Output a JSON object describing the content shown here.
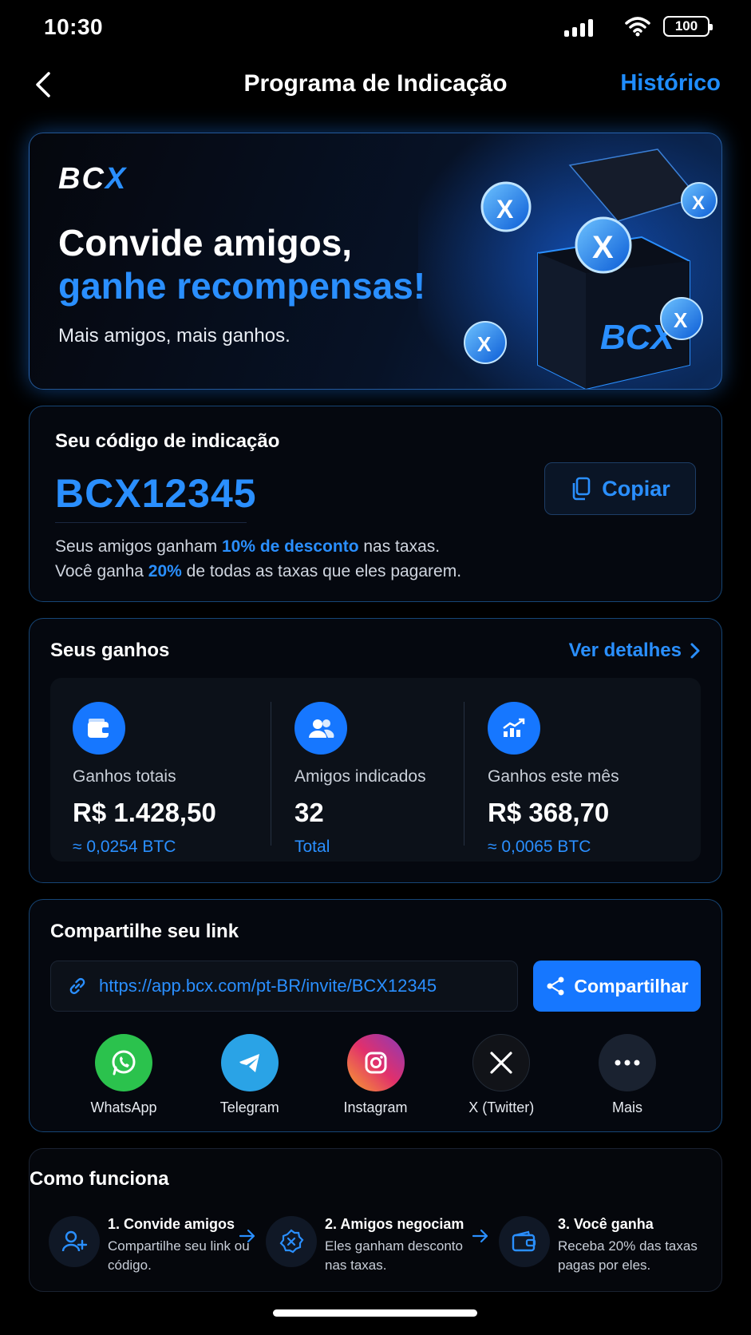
{
  "status_bar": {
    "time": "10:30",
    "battery": "100"
  },
  "nav": {
    "title": "Programa de Indicação",
    "history": "Histórico"
  },
  "hero": {
    "logo_prefix": "BC",
    "logo_accent": "X",
    "headline_1": "Convide amigos,",
    "headline_2": "ganhe recompensas!",
    "subtitle": "Mais amigos, mais ganhos.",
    "box_label": "BCX"
  },
  "referral_code": {
    "label": "Seu código de indicação",
    "code": "BCX12345",
    "copy_label": "Copiar",
    "desc_line1_a": "Seus amigos ganham ",
    "desc_line1_hl": "10% de desconto",
    "desc_line1_b": " nas taxas.",
    "desc_line2_a": "Você ganha ",
    "desc_line2_hl": "20%",
    "desc_line2_b": " de todas as taxas que eles pagarem."
  },
  "earnings": {
    "label": "Seus ganhos",
    "details_link": "Ver detalhes",
    "stats": [
      {
        "icon": "wallet-icon",
        "title": "Ganhos totais",
        "value": "R$ 1.428,50",
        "sub": "≈ 0,0254 BTC"
      },
      {
        "icon": "users-icon",
        "title": "Amigos indicados",
        "value": "32",
        "sub": "Total"
      },
      {
        "icon": "chart-icon",
        "title": "Ganhos este mês",
        "value": "R$ 368,70",
        "sub": "≈ 0,0065 BTC"
      }
    ]
  },
  "share": {
    "label": "Compartilhe seu link",
    "link": "https://app.bcx.com/pt-BR/invite/BCX12345",
    "button": "Compartilhar",
    "apps": [
      {
        "name": "WhatsApp",
        "icon": "whatsapp-icon",
        "color": "#25d366"
      },
      {
        "name": "Telegram",
        "icon": "telegram-icon",
        "color": "#2aa3e6"
      },
      {
        "name": "Instagram",
        "icon": "instagram-icon",
        "color": "#e1306c"
      },
      {
        "name": "X (Twitter)",
        "icon": "x-icon",
        "color": "#111111"
      },
      {
        "name": "Mais",
        "icon": "more-icon",
        "color": "#1a2230"
      }
    ]
  },
  "how": {
    "label": "Como funciona",
    "steps": [
      {
        "title": "1. Convide amigos",
        "desc": "Compartilhe seu link ou código."
      },
      {
        "title": "2. Amigos negociam",
        "desc": "Eles ganham desconto nas taxas."
      },
      {
        "title": "3. Você ganha",
        "desc": "Receba 20% das taxas pagas por eles."
      }
    ]
  },
  "colors": {
    "accent": "#1677ff",
    "link": "#2a8fff",
    "background": "#000000"
  }
}
